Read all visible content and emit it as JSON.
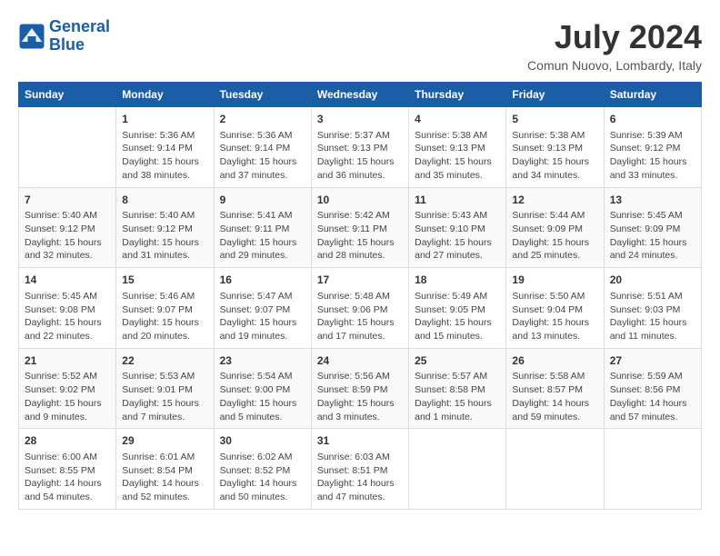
{
  "header": {
    "logo_line1": "General",
    "logo_line2": "Blue",
    "month_year": "July 2024",
    "location": "Comun Nuovo, Lombardy, Italy"
  },
  "days_of_week": [
    "Sunday",
    "Monday",
    "Tuesday",
    "Wednesday",
    "Thursday",
    "Friday",
    "Saturday"
  ],
  "weeks": [
    [
      {
        "day": "",
        "content": ""
      },
      {
        "day": "1",
        "content": "Sunrise: 5:36 AM\nSunset: 9:14 PM\nDaylight: 15 hours\nand 38 minutes."
      },
      {
        "day": "2",
        "content": "Sunrise: 5:36 AM\nSunset: 9:14 PM\nDaylight: 15 hours\nand 37 minutes."
      },
      {
        "day": "3",
        "content": "Sunrise: 5:37 AM\nSunset: 9:13 PM\nDaylight: 15 hours\nand 36 minutes."
      },
      {
        "day": "4",
        "content": "Sunrise: 5:38 AM\nSunset: 9:13 PM\nDaylight: 15 hours\nand 35 minutes."
      },
      {
        "day": "5",
        "content": "Sunrise: 5:38 AM\nSunset: 9:13 PM\nDaylight: 15 hours\nand 34 minutes."
      },
      {
        "day": "6",
        "content": "Sunrise: 5:39 AM\nSunset: 9:12 PM\nDaylight: 15 hours\nand 33 minutes."
      }
    ],
    [
      {
        "day": "7",
        "content": "Sunrise: 5:40 AM\nSunset: 9:12 PM\nDaylight: 15 hours\nand 32 minutes."
      },
      {
        "day": "8",
        "content": "Sunrise: 5:40 AM\nSunset: 9:12 PM\nDaylight: 15 hours\nand 31 minutes."
      },
      {
        "day": "9",
        "content": "Sunrise: 5:41 AM\nSunset: 9:11 PM\nDaylight: 15 hours\nand 29 minutes."
      },
      {
        "day": "10",
        "content": "Sunrise: 5:42 AM\nSunset: 9:11 PM\nDaylight: 15 hours\nand 28 minutes."
      },
      {
        "day": "11",
        "content": "Sunrise: 5:43 AM\nSunset: 9:10 PM\nDaylight: 15 hours\nand 27 minutes."
      },
      {
        "day": "12",
        "content": "Sunrise: 5:44 AM\nSunset: 9:09 PM\nDaylight: 15 hours\nand 25 minutes."
      },
      {
        "day": "13",
        "content": "Sunrise: 5:45 AM\nSunset: 9:09 PM\nDaylight: 15 hours\nand 24 minutes."
      }
    ],
    [
      {
        "day": "14",
        "content": "Sunrise: 5:45 AM\nSunset: 9:08 PM\nDaylight: 15 hours\nand 22 minutes."
      },
      {
        "day": "15",
        "content": "Sunrise: 5:46 AM\nSunset: 9:07 PM\nDaylight: 15 hours\nand 20 minutes."
      },
      {
        "day": "16",
        "content": "Sunrise: 5:47 AM\nSunset: 9:07 PM\nDaylight: 15 hours\nand 19 minutes."
      },
      {
        "day": "17",
        "content": "Sunrise: 5:48 AM\nSunset: 9:06 PM\nDaylight: 15 hours\nand 17 minutes."
      },
      {
        "day": "18",
        "content": "Sunrise: 5:49 AM\nSunset: 9:05 PM\nDaylight: 15 hours\nand 15 minutes."
      },
      {
        "day": "19",
        "content": "Sunrise: 5:50 AM\nSunset: 9:04 PM\nDaylight: 15 hours\nand 13 minutes."
      },
      {
        "day": "20",
        "content": "Sunrise: 5:51 AM\nSunset: 9:03 PM\nDaylight: 15 hours\nand 11 minutes."
      }
    ],
    [
      {
        "day": "21",
        "content": "Sunrise: 5:52 AM\nSunset: 9:02 PM\nDaylight: 15 hours\nand 9 minutes."
      },
      {
        "day": "22",
        "content": "Sunrise: 5:53 AM\nSunset: 9:01 PM\nDaylight: 15 hours\nand 7 minutes."
      },
      {
        "day": "23",
        "content": "Sunrise: 5:54 AM\nSunset: 9:00 PM\nDaylight: 15 hours\nand 5 minutes."
      },
      {
        "day": "24",
        "content": "Sunrise: 5:56 AM\nSunset: 8:59 PM\nDaylight: 15 hours\nand 3 minutes."
      },
      {
        "day": "25",
        "content": "Sunrise: 5:57 AM\nSunset: 8:58 PM\nDaylight: 15 hours\nand 1 minute."
      },
      {
        "day": "26",
        "content": "Sunrise: 5:58 AM\nSunset: 8:57 PM\nDaylight: 14 hours\nand 59 minutes."
      },
      {
        "day": "27",
        "content": "Sunrise: 5:59 AM\nSunset: 8:56 PM\nDaylight: 14 hours\nand 57 minutes."
      }
    ],
    [
      {
        "day": "28",
        "content": "Sunrise: 6:00 AM\nSunset: 8:55 PM\nDaylight: 14 hours\nand 54 minutes."
      },
      {
        "day": "29",
        "content": "Sunrise: 6:01 AM\nSunset: 8:54 PM\nDaylight: 14 hours\nand 52 minutes."
      },
      {
        "day": "30",
        "content": "Sunrise: 6:02 AM\nSunset: 8:52 PM\nDaylight: 14 hours\nand 50 minutes."
      },
      {
        "day": "31",
        "content": "Sunrise: 6:03 AM\nSunset: 8:51 PM\nDaylight: 14 hours\nand 47 minutes."
      },
      {
        "day": "",
        "content": ""
      },
      {
        "day": "",
        "content": ""
      },
      {
        "day": "",
        "content": ""
      }
    ]
  ]
}
